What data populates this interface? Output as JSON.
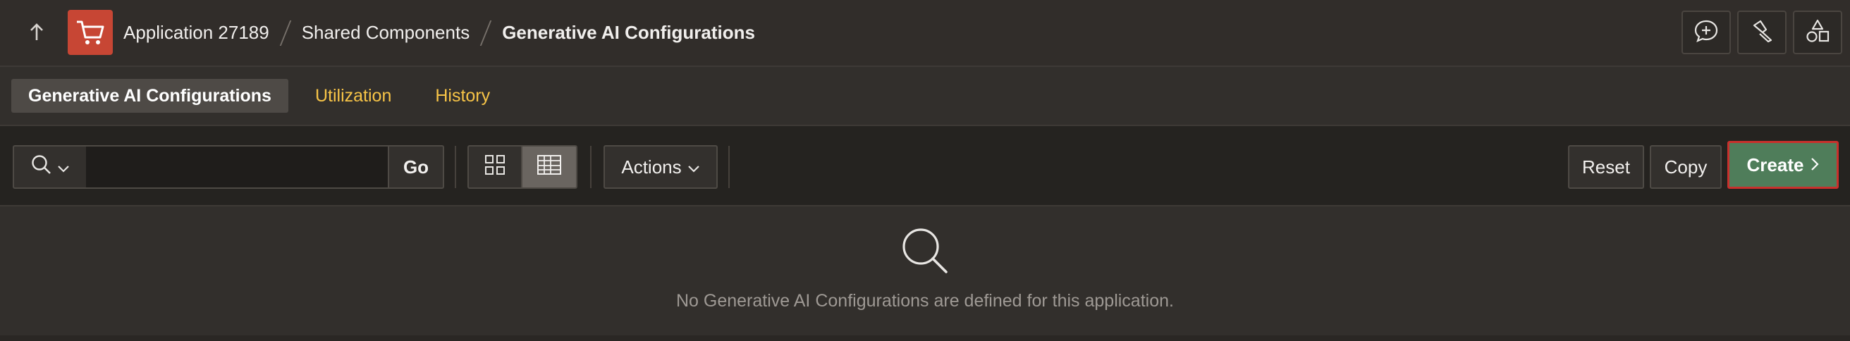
{
  "header": {
    "app_name": "Application 27189",
    "breadcrumb": [
      "Shared Components",
      "Generative AI Configurations"
    ],
    "icons": [
      "up-arrow-icon",
      "shopping-cart-icon",
      "comment-plus-icon",
      "flashlight-icon",
      "shapes-icon"
    ]
  },
  "tabs": [
    {
      "label": "Generative AI Configurations",
      "active": true
    },
    {
      "label": "Utilization",
      "active": false
    },
    {
      "label": "History",
      "active": false
    }
  ],
  "toolbar": {
    "search_placeholder": "",
    "go_label": "Go",
    "actions_label": "Actions",
    "reset_label": "Reset",
    "copy_label": "Copy",
    "create_label": "Create",
    "view_modes": [
      "icon-view",
      "report-view"
    ],
    "selected_view": "report-view"
  },
  "empty_state": {
    "message": "No Generative AI Configurations are defined for this application."
  },
  "colors": {
    "brand": "#c74634",
    "create_button": "#4f7d5a",
    "highlight_outline": "#c9302c",
    "tab_link": "#f7c447"
  }
}
